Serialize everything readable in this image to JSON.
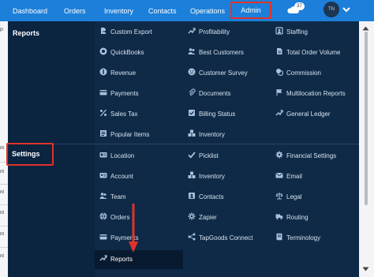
{
  "nav": {
    "items": [
      "Dashboard",
      "Orders",
      "Inventory",
      "Contacts",
      "Operations"
    ],
    "admin": "Admin",
    "notification_count": "37",
    "avatar_initials": "TN"
  },
  "background_page": {
    "letters": [
      "P",
      "nt",
      "nt",
      "nt",
      "nt",
      "nt",
      "nt"
    ]
  },
  "menu": {
    "sections": [
      "Reports",
      "Settings"
    ],
    "reports": {
      "col1": [
        "Custom Export",
        "QuickBooks",
        "Revenue",
        "Payments",
        "Sales Tax",
        "Popular Items"
      ],
      "col2": [
        "Profitability",
        "Best Customers",
        "Customer Survey",
        "Documents",
        "Billing Status",
        "Inventory"
      ],
      "col3": [
        "Staffing",
        "Total Order Volume",
        "Commission",
        "Multilocation Reports",
        "General Ledger"
      ]
    },
    "settings": {
      "col1": [
        "Location",
        "Account",
        "Team",
        "Orders",
        "Payments",
        "Reports"
      ],
      "col2": [
        "Picklist",
        "Inventory",
        "Contacts",
        "Zapier",
        "TapGoods Connect"
      ],
      "col3": [
        "Financial Settings",
        "Email",
        "Legal",
        "Routing",
        "Terminology"
      ]
    }
  },
  "colors": {
    "nav_bg": "#1c7fd9",
    "menu_bg": "#0e2a47",
    "highlight_border": "#e0332a"
  }
}
